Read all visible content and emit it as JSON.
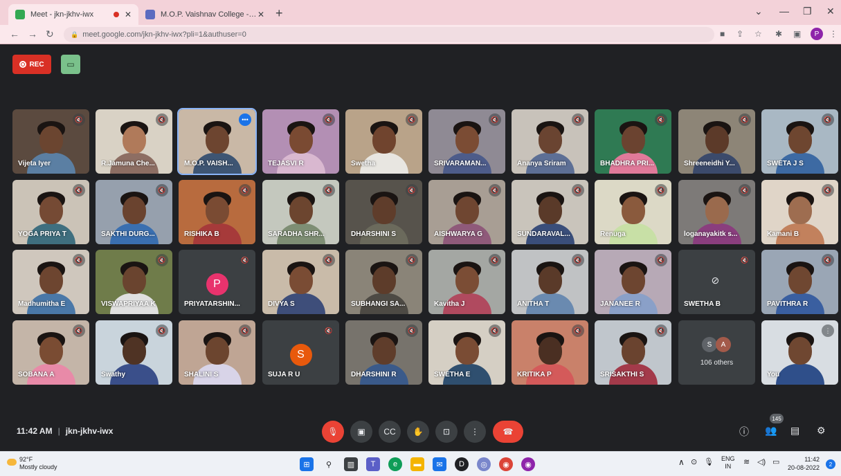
{
  "browser": {
    "tabs": [
      {
        "title": "Meet - jkn-jkhv-iwx",
        "active": true
      },
      {
        "title": "M.O.P. Vaishnav College -Virtual",
        "active": false
      }
    ],
    "url": "meet.google.com/jkn-jkhv-iwx?pli=1&authuser=0",
    "profile_initial": "P"
  },
  "meet": {
    "rec_label": "REC",
    "participants": [
      {
        "name": "Vijeta Iyer",
        "type": "video",
        "bg": "#5b4a3f",
        "skin": "#6b4530",
        "cloth": "#5b7fa3"
      },
      {
        "name": "R.Jamuna Che...",
        "type": "video",
        "bg": "#d9d2c5",
        "skin": "#b07a5a",
        "cloth": "#8d6e63"
      },
      {
        "name": "M.O.P. VAISH...",
        "type": "video",
        "bg": "#c9b8a6",
        "skin": "#6d4530",
        "cloth": "#3e5573",
        "pinned": true
      },
      {
        "name": "TEJASVI R",
        "type": "video",
        "bg": "#b38fb4",
        "skin": "#7a4a32",
        "cloth": "#d9b8d0"
      },
      {
        "name": "Swetha",
        "type": "video",
        "bg": "#b9a389",
        "skin": "#70442e",
        "cloth": "#e8e6e1"
      },
      {
        "name": "SRIVARAMAN...",
        "type": "video",
        "bg": "#8f8a94",
        "skin": "#7b4c34",
        "cloth": "#4d5c8a"
      },
      {
        "name": "Ananya Sriram",
        "type": "video",
        "bg": "#c8c2ba",
        "skin": "#6a4431",
        "cloth": "#5d6f95"
      },
      {
        "name": "BHADHRA PRI...",
        "type": "video",
        "bg": "#2f7a53",
        "skin": "#6b4330",
        "cloth": "#e07a9a"
      },
      {
        "name": "Shreeneidhi Y...",
        "type": "video",
        "bg": "#8d8577",
        "skin": "#5c3a29",
        "cloth": "#3b4a6b"
      },
      {
        "name": "SWETA J S",
        "type": "video",
        "bg": "#a9b8c4",
        "skin": "#6e4630",
        "cloth": "#3d6aa3"
      },
      {
        "name": "YOGA PRIYA T",
        "type": "video",
        "bg": "#cbc3b7",
        "skin": "#754a34",
        "cloth": "#3f6f7f"
      },
      {
        "name": "SAKTHI DURG...",
        "type": "video",
        "bg": "#96a0ad",
        "skin": "#6a432f",
        "cloth": "#3a6fb0"
      },
      {
        "name": "RISHIKA B",
        "type": "video",
        "bg": "#b86b3e",
        "skin": "#7a4b33",
        "cloth": "#a63a3a"
      },
      {
        "name": "SARADHA SHR...",
        "type": "video",
        "bg": "#c4c8be",
        "skin": "#6c452f",
        "cloth": "#7e8e74"
      },
      {
        "name": "DHARSHINI S",
        "type": "video",
        "bg": "#57534c",
        "skin": "#5f3d2b",
        "cloth": "#6b6a5c"
      },
      {
        "name": "AISHWARYA G",
        "type": "video",
        "bg": "#a89e94",
        "skin": "#6f4631",
        "cloth": "#8f5a7a"
      },
      {
        "name": "SUNDARAVAL...",
        "type": "video",
        "bg": "#c9c4bb",
        "skin": "#5a3a29",
        "cloth": "#3a4e7a"
      },
      {
        "name": "Renuga",
        "type": "video",
        "bg": "#dcd9c6",
        "skin": "#8a5a3d",
        "cloth": "#c8e0a6"
      },
      {
        "name": "loganayakitk s...",
        "type": "video",
        "bg": "#7d7a78",
        "skin": "#9a6a4d",
        "cloth": "#8a3e7e"
      },
      {
        "name": "Kamani B",
        "type": "video",
        "bg": "#e0d5c8",
        "skin": "#9e6d50",
        "cloth": "#c2815d"
      },
      {
        "name": "Madhumitha E",
        "type": "video",
        "bg": "#cfc7bd",
        "skin": "#6d4530",
        "cloth": "#4a78a8"
      },
      {
        "name": "VISWAPRIYAA K",
        "type": "video",
        "bg": "#6f7c4a",
        "skin": "#6a442f",
        "cloth": "#e0e0e0"
      },
      {
        "name": "PRIYATARSHIN...",
        "type": "avatar",
        "initial": "P",
        "color": "#e8336d"
      },
      {
        "name": "DIVYA S",
        "type": "video",
        "bg": "#c9bba9",
        "skin": "#7a4c34",
        "cloth": "#3e4e7a"
      },
      {
        "name": "SUBHANGI SA...",
        "type": "video",
        "bg": "#8a8478",
        "skin": "#5d3c2a",
        "cloth": "#4d4a44"
      },
      {
        "name": "Kavitha J",
        "type": "video",
        "bg": "#a4a7a3",
        "skin": "#7b4d35",
        "cloth": "#b04a5f"
      },
      {
        "name": "ANITHA T",
        "type": "video",
        "bg": "#c0c2c4",
        "skin": "#5a3a29",
        "cloth": "#6a8ab0"
      },
      {
        "name": "JANANEE R",
        "type": "video",
        "bg": "#b7a9b6",
        "skin": "#6d4530",
        "cloth": "#8aa0c8"
      },
      {
        "name": "SWETHA B",
        "type": "camoff"
      },
      {
        "name": "PAVITHRA R",
        "type": "video",
        "bg": "#9aa6b5",
        "skin": "#6f4731",
        "cloth": "#3a5fa0"
      },
      {
        "name": "SOBANA A",
        "type": "video",
        "bg": "#c4b5a8",
        "skin": "#7a4c33",
        "cloth": "#e88aa8"
      },
      {
        "name": "Swathy",
        "type": "video",
        "bg": "#c9d4dc",
        "skin": "#4f3324",
        "cloth": "#3a4f8a"
      },
      {
        "name": "SHALINI S",
        "type": "video",
        "bg": "#bfa594",
        "skin": "#6c452f",
        "cloth": "#d8d4e8"
      },
      {
        "name": "SUJA R U",
        "type": "avatar",
        "initial": "S",
        "color": "#e8590c"
      },
      {
        "name": "DHARSHINI R",
        "type": "video",
        "bg": "#77736c",
        "skin": "#5f3d2b",
        "cloth": "#3a5a8a"
      },
      {
        "name": "SWETHA E",
        "type": "video",
        "bg": "#d5cfc4",
        "skin": "#7a4c34",
        "cloth": "#2f4f6f"
      },
      {
        "name": "KRITIKA P",
        "type": "video",
        "bg": "#c9816a",
        "skin": "#4a2f22",
        "cloth": "#d45a5a"
      },
      {
        "name": "SRISAKTHI S",
        "type": "video",
        "bg": "#c0c6cc",
        "skin": "#6a432f",
        "cloth": "#a33a4a"
      },
      {
        "name": "106 others",
        "type": "others",
        "initials": [
          "S",
          "A"
        ]
      },
      {
        "name": "You",
        "type": "video",
        "bg": "#d8dde2",
        "skin": "#6f4731",
        "cloth": "#2f4f8a"
      }
    ]
  },
  "bottom": {
    "time": "11:42 AM",
    "meeting_code": "jkn-jkhv-iwx",
    "people_count": "145"
  },
  "taskbar": {
    "temperature": "92°F",
    "weather": "Mostly cloudy",
    "lang_top": "ENG",
    "lang_bottom": "IN",
    "clock_time": "11:42",
    "clock_date": "20-08-2022",
    "notification_count": "2"
  },
  "colors": {
    "meet_bg": "#202124",
    "control_bg": "#3c4043",
    "danger": "#ea4335",
    "chrome_tab": "#f3d2d9"
  }
}
